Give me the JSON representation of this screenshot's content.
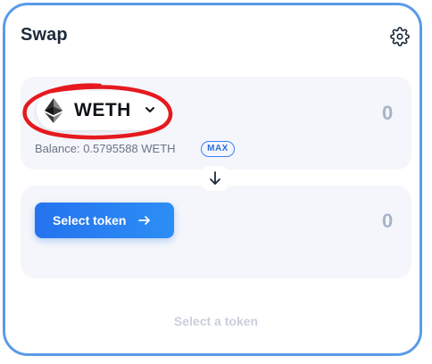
{
  "header": {
    "title": "Swap",
    "settings_icon": "gear-icon"
  },
  "from": {
    "token_symbol": "WETH",
    "token_icon": "ethereum-icon",
    "amount": "0",
    "balance_text": "Balance: 0.5795588 WETH",
    "max_label": "MAX"
  },
  "to": {
    "select_label": "Select token",
    "arrow_icon": "arrow-right-icon",
    "amount": "0"
  },
  "switch": {
    "icon": "arrow-down-icon"
  },
  "footer": {
    "status_text": "Select a token"
  },
  "annotation": {
    "color": "#e5191e",
    "shape": "hand-drawn-circle"
  },
  "colors": {
    "frame_border": "#5b9ae8",
    "accent": "#2573ee",
    "panel_bg": "#f4f6fb",
    "muted_text": "#a8b3c7"
  }
}
